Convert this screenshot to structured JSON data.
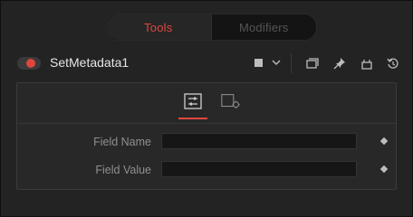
{
  "tabs": [
    {
      "label": "Tools",
      "active": true
    },
    {
      "label": "Modifiers",
      "active": false
    }
  ],
  "node": {
    "name": "SetMetadata1",
    "enabled": true,
    "accent_color": "#e0463e"
  },
  "header_icons": [
    "color-swatch-icon",
    "chevron-down-icon",
    "versions-icon",
    "pin-icon",
    "lock-icon",
    "reset-icon"
  ],
  "panel": {
    "subtabs": [
      {
        "icon": "controls-sliders-icon",
        "active": true
      },
      {
        "icon": "settings-gear-icon",
        "active": false
      }
    ],
    "fields": [
      {
        "label": "Field Name",
        "value": ""
      },
      {
        "label": "Field Value",
        "value": ""
      }
    ]
  }
}
